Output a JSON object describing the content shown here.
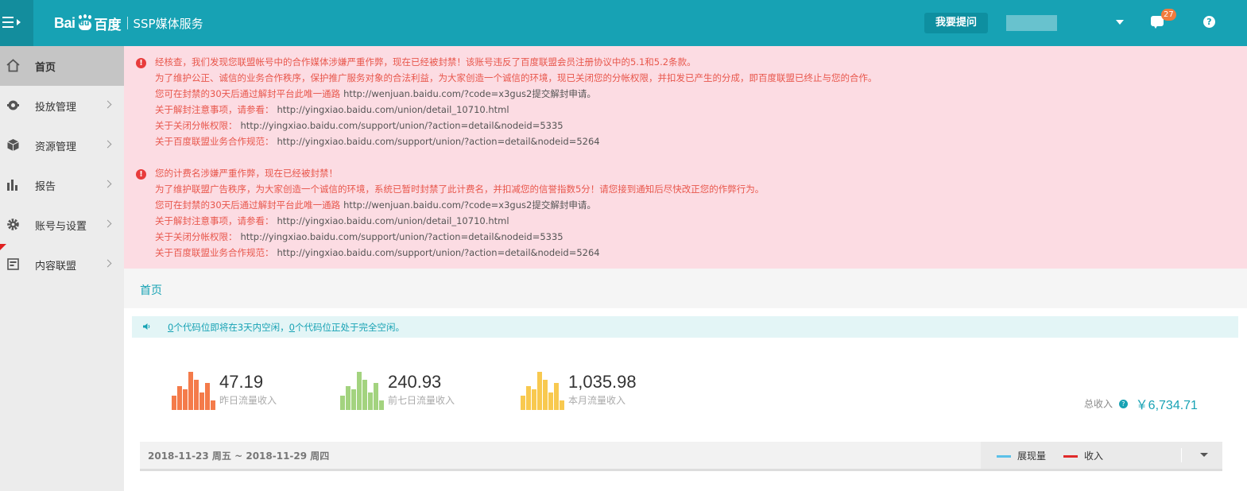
{
  "header": {
    "logo_bai": "Bai",
    "logo_du": "du",
    "logo_cn": "百度",
    "service_name": "SSP媒体服务",
    "ask_button": "我要提问",
    "message_count": "27",
    "help_glyph": "?"
  },
  "sidebar": {
    "items": [
      {
        "label": "首页",
        "icon": "home-icon",
        "active": true
      },
      {
        "label": "投放管理",
        "icon": "shield-icon"
      },
      {
        "label": "资源管理",
        "icon": "cube-icon"
      },
      {
        "label": "报告",
        "icon": "bar-chart-icon"
      },
      {
        "label": "账号与设置",
        "icon": "gear-icon"
      },
      {
        "label": "内容联盟",
        "icon": "document-icon"
      }
    ]
  },
  "alerts": [
    {
      "lines": [
        {
          "text": "经核查，我们发现您联盟帐号中的合作媒体涉嫌严重作弊，现在已经被封禁！该账号违反了百度联盟会员注册协议中的5.1和5.2条款。",
          "url": ""
        },
        {
          "text": "为了维护公正、诚信的业务合作秩序，保护推广服务对象的合法利益，为大家创造一个诚信的环境，现已关闭您的分帐权限，并扣发已产生的分成，即百度联盟已终止与您的合作。",
          "url": ""
        },
        {
          "text": "您可在封禁的30天后通过解封平台此唯一通路",
          "url": "http://wenjuan.baidu.com/?code=x3gus2提交解封申请。"
        },
        {
          "text": "关于解封注意事项，请参看：",
          "url": "http://yingxiao.baidu.com/union/detail_10710.html"
        },
        {
          "text": "关于关闭分帐权限：",
          "url": "http://yingxiao.baidu.com/support/union/?action=detail&nodeid=5335"
        },
        {
          "text": "关于百度联盟业务合作规范：",
          "url": "http://yingxiao.baidu.com/support/union/?action=detail&nodeid=5264"
        }
      ]
    },
    {
      "lines": [
        {
          "text": "您的计费名涉嫌严重作弊，现在已经被封禁！",
          "url": ""
        },
        {
          "text": "为了维护联盟广告秩序，为大家创造一个诚信的环境，系统已暂时封禁了此计费名，并扣减您的信誉指数5分！请您接到通知后尽快改正您的作弊行为。",
          "url": ""
        },
        {
          "text": "您可在封禁的30天后通过解封平台此唯一通路",
          "url": "http://wenjuan.baidu.com/?code=x3gus2提交解封申请。"
        },
        {
          "text": "关于解封注意事项，请参看：",
          "url": "http://yingxiao.baidu.com/union/detail_10710.html"
        },
        {
          "text": "关于关闭分帐权限：",
          "url": "http://yingxiao.baidu.com/support/union/?action=detail&nodeid=5335"
        },
        {
          "text": "关于百度联盟业务合作规范：",
          "url": "http://yingxiao.baidu.com/support/union/?action=detail&nodeid=5264"
        }
      ]
    }
  ],
  "page": {
    "title": "首页"
  },
  "notice": {
    "count1": "0",
    "text1": "个代码位即将在3天内空闲，",
    "count2": "0",
    "text2": "个代码位正处于完全空闲。"
  },
  "stats": [
    {
      "value": "47.19",
      "label": "昨日流量收入",
      "color": "#f47b4a"
    },
    {
      "value": "240.93",
      "label": "前七日流量收入",
      "color": "#a3d37f"
    },
    {
      "value": "1,035.98",
      "label": "本月流量收入",
      "color": "#f8c94f"
    }
  ],
  "total": {
    "label": "总收入",
    "value": "￥6,734.71"
  },
  "range": {
    "text": "2018-11-23 周五 ~ 2018-11-29 周四",
    "legend": [
      {
        "label": "展现量",
        "color": "#5bc0e8"
      },
      {
        "label": "收入",
        "color": "#e02a2a"
      }
    ]
  }
}
